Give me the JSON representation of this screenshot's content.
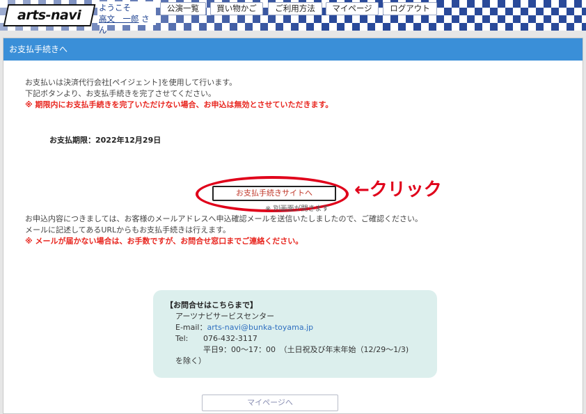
{
  "header": {
    "logo_text": "arts-navi",
    "welcome": "ようこそ",
    "user_name": "高文　一郎",
    "user_suffix": "さん",
    "nav": [
      {
        "label": "公演一覧"
      },
      {
        "label": "買い物かご"
      },
      {
        "label": "ご利用方法"
      },
      {
        "label": "マイページ"
      },
      {
        "label": "ログアウト"
      }
    ]
  },
  "panel": {
    "title": "お支払手続きへ",
    "intro_line1": "お支払いは決済代行会社[ペイジェント]を使用して行います。",
    "intro_line2": "下記ボタンより、お支払手続きを完了させてください。",
    "intro_warning": "※ 期限内にお支払手続きを完了いただけない場合、お申込は無効とさせていただきます。",
    "deadline": "お支払期限：2022年12月29日",
    "pay_button": "お支払手続きサイトへ",
    "popup_note": "※ 別画面が開きます",
    "click_annotation": "←クリック",
    "mail_line1": "お申込内容につきましては、お客様のメールアドレスへ申込確認メールを送信いたしましたので、ご確認ください。",
    "mail_line2": "メールに記述してあるURLからもお支払手続きは行えます。",
    "mail_warning": "※ メールが届かない場合は、お手数ですが、お問合せ窓口までご連絡ください。"
  },
  "contact": {
    "heading": "【お問合せはこちらまで】",
    "org": "アーツナビサービスセンター",
    "email_label": "E-mail：",
    "email": "arts-navi@bunka-toyama.jp",
    "tel_label": "Tel:",
    "tel": "076-432-3117",
    "hours": "平日9：00～17：00　（土日祝及び年末年始（12/29～1/3)",
    "hours_cont": "を除く）"
  },
  "footer": {
    "mypage_button": "マイページへ"
  },
  "colors": {
    "panel_header": "#3a8fd8",
    "warning": "#e8261f",
    "annotation": "#e0001a",
    "contact_bg": "#dcefed",
    "checker": "#2a4a9a"
  }
}
